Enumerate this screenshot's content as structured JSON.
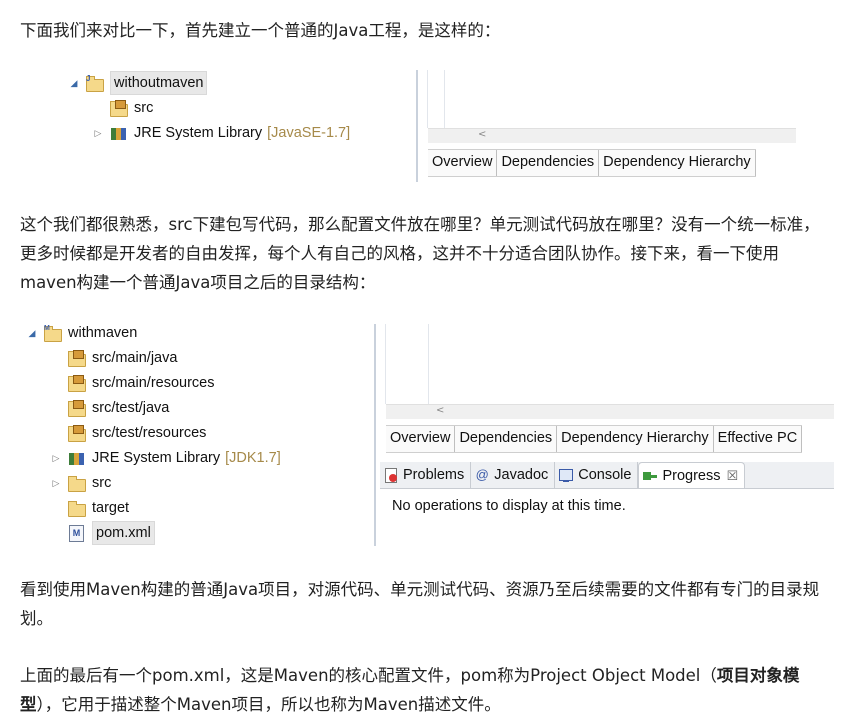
{
  "paragraphs": {
    "p1": "下面我们来对比一下，首先建立一个普通的Java工程，是这样的：",
    "p2": "这个我们都很熟悉，src下建包写代码，那么配置文件放在哪里？单元测试代码放在哪里？没有一个统一标准，更多时候都是开发者的自由发挥，每个人有自己的风格，这并不十分适合团队协作。接下来，看一下使用maven构建一个普通Java项目之后的目录结构：",
    "p3": "看到使用Maven构建的普通Java项目，对源代码、单元测试代码、资源乃至后续需要的文件都有专门的目录规划。",
    "p4_before": "上面的最后有一个pom.xml，这是Maven的核心配置文件，pom称为Project Object Model（",
    "p4_bold": "项目对象模型",
    "p4_after": "），它用于描述整个Maven项目，所以也称为Maven描述文件。"
  },
  "screenshot1": {
    "project": "withoutmaven",
    "items": [
      {
        "label": "src",
        "suffix": ""
      },
      {
        "label": "JRE System Library",
        "suffix": "[JavaSE-1.7]"
      }
    ],
    "scroll_glyph": "<",
    "tabs": [
      "Overview",
      "Dependencies",
      "Dependency Hierarchy"
    ]
  },
  "screenshot2": {
    "project": "withmaven",
    "items": [
      {
        "label": "src/main/java"
      },
      {
        "label": "src/main/resources"
      },
      {
        "label": "src/test/java"
      },
      {
        "label": "src/test/resources"
      },
      {
        "label": "JRE System Library",
        "suffix": "[JDK1.7]"
      },
      {
        "label": "src"
      },
      {
        "label": "target"
      },
      {
        "label": "pom.xml"
      }
    ],
    "scroll_glyph": "<",
    "tabs": [
      "Overview",
      "Dependencies",
      "Dependency Hierarchy",
      "Effective PC"
    ],
    "view_tabs": [
      "Problems",
      "Javadoc",
      "Console",
      "Progress"
    ],
    "close_glyph": "☒",
    "progress_message": "No operations to display at this time."
  },
  "colors": {
    "folder": "#f5d98a",
    "library_suffix": "#a68a4a",
    "panel_border": "#c9d1dc"
  }
}
